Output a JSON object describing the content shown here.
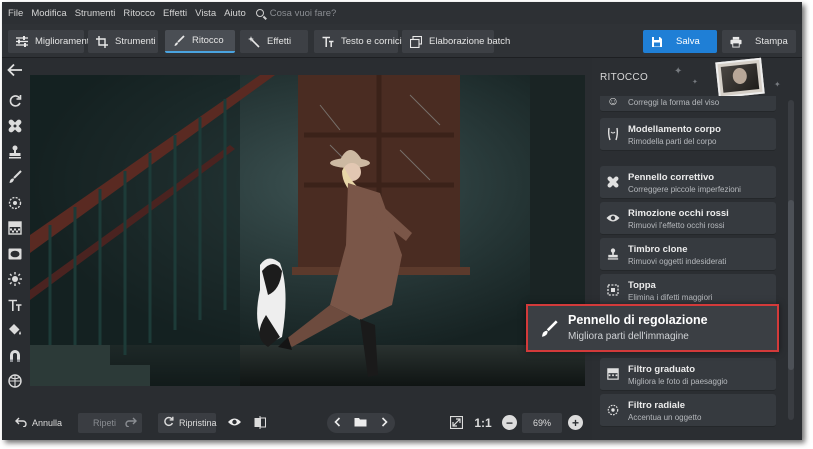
{
  "menu": [
    "File",
    "Modifica",
    "Strumenti",
    "Ritocco",
    "Effetti",
    "Vista",
    "Aiuto"
  ],
  "search": {
    "placeholder": "Cosa vuoi fare?",
    "icon": "search-icon"
  },
  "toolbar": {
    "tabs": [
      {
        "label": "Miglioramento",
        "icon": "sliders-icon"
      },
      {
        "label": "Strumenti",
        "icon": "crop-icon"
      },
      {
        "label": "Ritocco",
        "icon": "brush-icon",
        "active": true
      },
      {
        "label": "Effetti",
        "icon": "magic-wand-icon"
      },
      {
        "label": "Testo e cornici",
        "icon": "text-icon"
      },
      {
        "label": "Elaborazione batch",
        "icon": "batch-icon"
      }
    ],
    "save_label": "Salva",
    "print_label": "Stampa"
  },
  "panel": {
    "title": "RITOCCO",
    "items": [
      {
        "title": "",
        "subtitle": "Correggi la forma del viso",
        "icon": "face-icon"
      },
      {
        "title": "Modellamento corpo",
        "subtitle": "Rimodella parti del corpo",
        "icon": "body-icon"
      },
      {
        "title": "Pennello correttivo",
        "subtitle": "Correggere piccole imperfezioni",
        "icon": "bandage-icon"
      },
      {
        "title": "Rimozione occhi rossi",
        "subtitle": "Rimuovi l'effetto occhi rossi",
        "icon": "eye-icon"
      },
      {
        "title": "Timbro clone",
        "subtitle": "Rimuovi oggetti indesiderati",
        "icon": "stamp-icon"
      },
      {
        "title": "Toppa",
        "subtitle": "Elimina i difetti maggiori",
        "icon": "patch-icon"
      },
      {
        "title": "Filtro graduato",
        "subtitle": "Migliora le foto di paesaggio",
        "icon": "gradient-icon"
      },
      {
        "title": "Filtro radiale",
        "subtitle": "Accentua un oggetto",
        "icon": "radial-icon"
      }
    ],
    "highlight": {
      "title": "Pennello di regolazione",
      "subtitle": "Migliora parti dell'immagine",
      "icon": "brush-icon",
      "border_color": "#d33a3a"
    }
  },
  "bottom": {
    "undo_label": "Annulla",
    "redo_label": "Ripeti",
    "reset_label": "Ripristina",
    "ratio_label": "1:1",
    "zoom": "69%"
  },
  "colors": {
    "accent": "#1f7fd6",
    "active_tab_line": "#4aa3df",
    "background": "#2a2d31"
  }
}
